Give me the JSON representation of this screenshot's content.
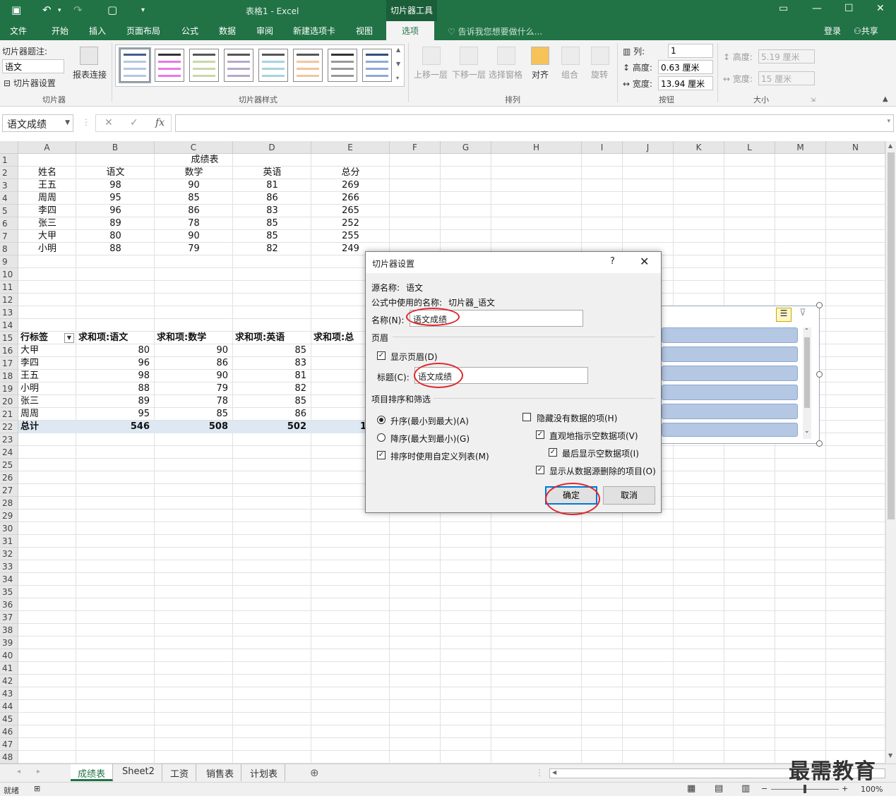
{
  "titlebar": {
    "title": "表格1 - Excel",
    "context_tab": "切片器工具",
    "undo": "↶",
    "redo": "↷"
  },
  "tabs": [
    {
      "label": "文件"
    },
    {
      "label": "开始"
    },
    {
      "label": "插入"
    },
    {
      "label": "页面布局"
    },
    {
      "label": "公式"
    },
    {
      "label": "数据"
    },
    {
      "label": "审阅"
    },
    {
      "label": "新建选项卡"
    },
    {
      "label": "视图"
    },
    {
      "label": "选项"
    }
  ],
  "tell_me": "告诉我您想要做什么...",
  "login": "登录",
  "share": "共享",
  "ribbon": {
    "caption_label": "切片器题注:",
    "caption_value": "语文",
    "slicer_settings": "切片器设置",
    "report_connections": "报表连接",
    "group_slicer": "切片器",
    "group_styles": "切片器样式",
    "bring_forward": "上移一层",
    "send_backward": "下移一层",
    "selection_pane": "选择窗格",
    "align": "对齐",
    "group": "组合",
    "rotate": "旋转",
    "group_arrange": "排列",
    "columns_label": "列:",
    "columns_value": "1",
    "height_label": "高度:",
    "height_value": "0.63 厘米",
    "width_label": "宽度:",
    "width_value": "13.94 厘米",
    "group_buttons": "按钮",
    "size_height_label": "高度:",
    "size_height_value": "5.19 厘米",
    "size_width_label": "宽度:",
    "size_width_value": "15 厘米",
    "group_size": "大小"
  },
  "formula_bar": {
    "name_box": "语文成绩",
    "fx": "fx",
    "cancel": "✕",
    "enter": "✓"
  },
  "columns": [
    "A",
    "B",
    "C",
    "D",
    "E",
    "F",
    "G",
    "H",
    "I",
    "J",
    "K",
    "L",
    "M",
    "N"
  ],
  "rows": [
    "1",
    "2",
    "3",
    "4",
    "5",
    "6",
    "7",
    "8",
    "9",
    "10",
    "11",
    "12",
    "13",
    "14",
    "15",
    "16",
    "17",
    "18",
    "19",
    "20",
    "21",
    "22",
    "23",
    "24",
    "25",
    "26",
    "27",
    "28",
    "29",
    "30",
    "31",
    "32",
    "33",
    "34",
    "35",
    "36",
    "37",
    "38",
    "39",
    "40",
    "41",
    "42",
    "43",
    "44",
    "45",
    "46",
    "47",
    "48"
  ],
  "score_table": {
    "title": "成绩表",
    "headers": [
      "姓名",
      "语文",
      "数学",
      "英语",
      "总分"
    ],
    "rows": [
      [
        "王五",
        "98",
        "90",
        "81",
        "269"
      ],
      [
        "周周",
        "95",
        "85",
        "86",
        "266"
      ],
      [
        "李四",
        "96",
        "86",
        "83",
        "265"
      ],
      [
        "张三",
        "89",
        "78",
        "85",
        "252"
      ],
      [
        "大甲",
        "80",
        "90",
        "85",
        "255"
      ],
      [
        "小明",
        "88",
        "79",
        "82",
        "249"
      ]
    ]
  },
  "pivot": {
    "headers": [
      "行标签",
      "求和项:语文",
      "求和项:数学",
      "求和项:英语",
      "求和项:总"
    ],
    "rows": [
      [
        "大甲",
        "80",
        "90",
        "85"
      ],
      [
        "李四",
        "96",
        "86",
        "83"
      ],
      [
        "王五",
        "98",
        "90",
        "81"
      ],
      [
        "小明",
        "88",
        "79",
        "82"
      ],
      [
        "张三",
        "89",
        "78",
        "85"
      ],
      [
        "周周",
        "95",
        "85",
        "86"
      ]
    ],
    "total": [
      "总计",
      "546",
      "508",
      "502",
      "1"
    ]
  },
  "dialog": {
    "title": "切片器设置",
    "help": "?",
    "close": "✕",
    "source_label": "源名称:",
    "source_value": "语文",
    "formula_label": "公式中使用的名称:",
    "formula_value": "切片器_语文",
    "name_label": "名称(N):",
    "name_value": "语文成绩",
    "header_section": "页眉",
    "show_header": "显示页眉(D)",
    "caption_label": "标题(C):",
    "caption_value": "语文成绩",
    "sort_section": "项目排序和筛选",
    "ascending": "升序(最小到最大)(A)",
    "descending": "降序(最大到最小)(G)",
    "custom_list": "排序时使用自定义列表(M)",
    "hide_no_data": "隐藏没有数据的项(H)",
    "visually_indicate": "直观地指示空数据项(V)",
    "show_last": "最后显示空数据项(I)",
    "show_deleted": "显示从数据源删除的项目(O)",
    "ok": "确定",
    "cancel": "取消"
  },
  "sheet_tabs": [
    {
      "label": "成绩表"
    },
    {
      "label": "Sheet2"
    },
    {
      "label": "工资"
    },
    {
      "label": "销售表"
    },
    {
      "label": "计划表"
    }
  ],
  "status": {
    "ready": "就绪",
    "zoom": "100%"
  },
  "watermark": "最需教育",
  "colors": {
    "excel_green": "#217346",
    "slicer_item": "#b4c7e3",
    "annotation_red": "#e0262a",
    "total_row": "#dde8f3"
  }
}
